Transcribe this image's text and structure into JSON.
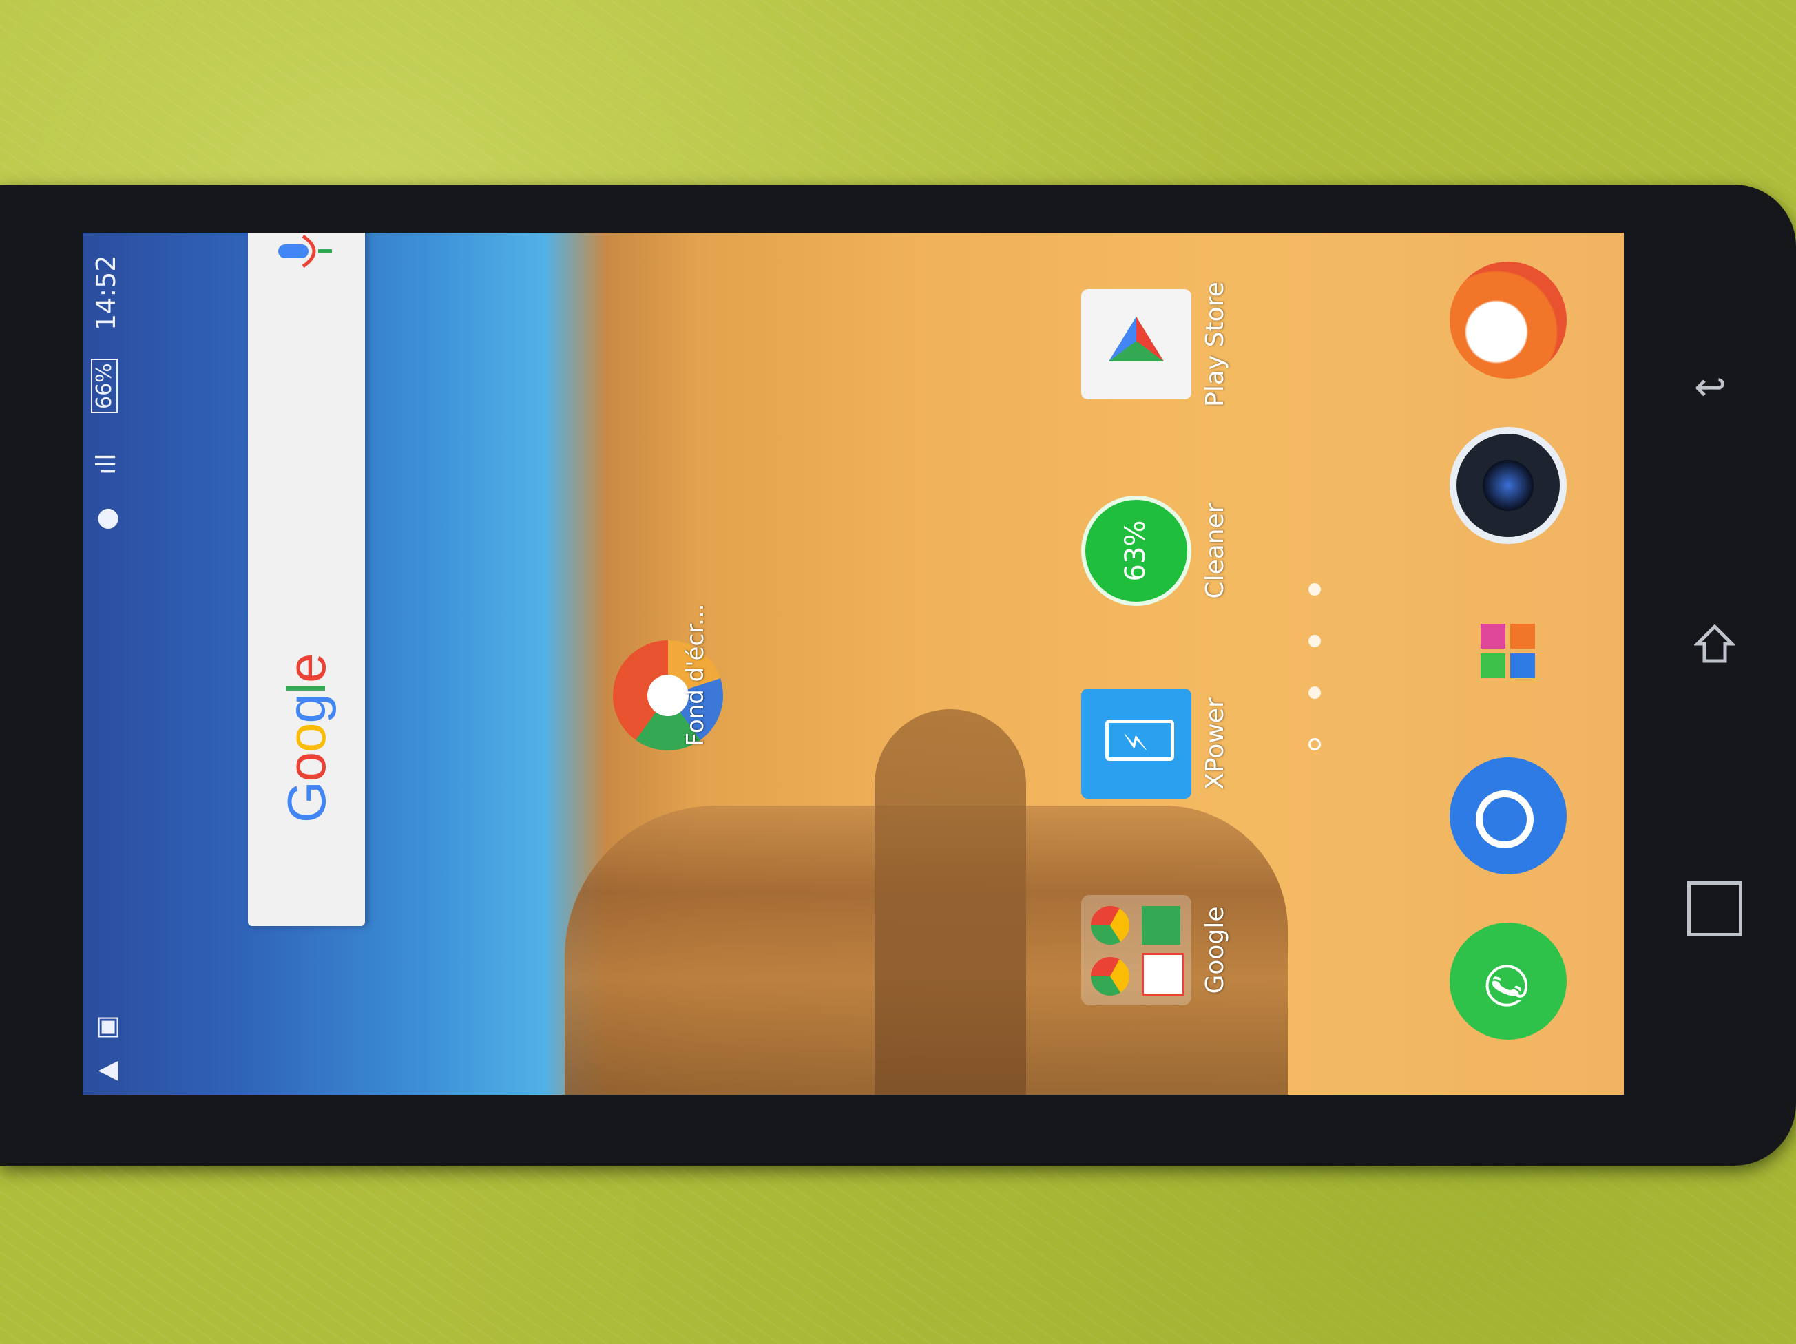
{
  "status_bar": {
    "time": "14:52",
    "battery": "66%",
    "icons": [
      "alert-icon",
      "image-notification-icon",
      "location-icon",
      "signal-icon",
      "battery-icon"
    ]
  },
  "search": {
    "logo": "Google",
    "mic_icon": "mic-icon"
  },
  "widget": {
    "label": "Fond d'écr..."
  },
  "apps": [
    {
      "label": "Google",
      "icon": "google-folder-icon"
    },
    {
      "label": "XPower",
      "icon": "xpower-icon"
    },
    {
      "label": "Cleaner",
      "icon": "cleaner-icon",
      "badge": "63%"
    },
    {
      "label": "Play Store",
      "icon": "play-store-icon"
    }
  ],
  "page_indicator": {
    "current": 1,
    "total": 4
  },
  "dock": [
    "phone-icon",
    "messages-icon",
    "app-drawer-icon",
    "camera-icon",
    "browser-icon"
  ],
  "navigation": [
    "recents-icon",
    "home-icon",
    "back-icon"
  ],
  "colors": {
    "sky": "#2f62b8",
    "sand": "#f0b25a",
    "phone_green": "#2fc24a",
    "messages_blue": "#2e7be6",
    "cleaner_green": "#1fbe3c"
  }
}
